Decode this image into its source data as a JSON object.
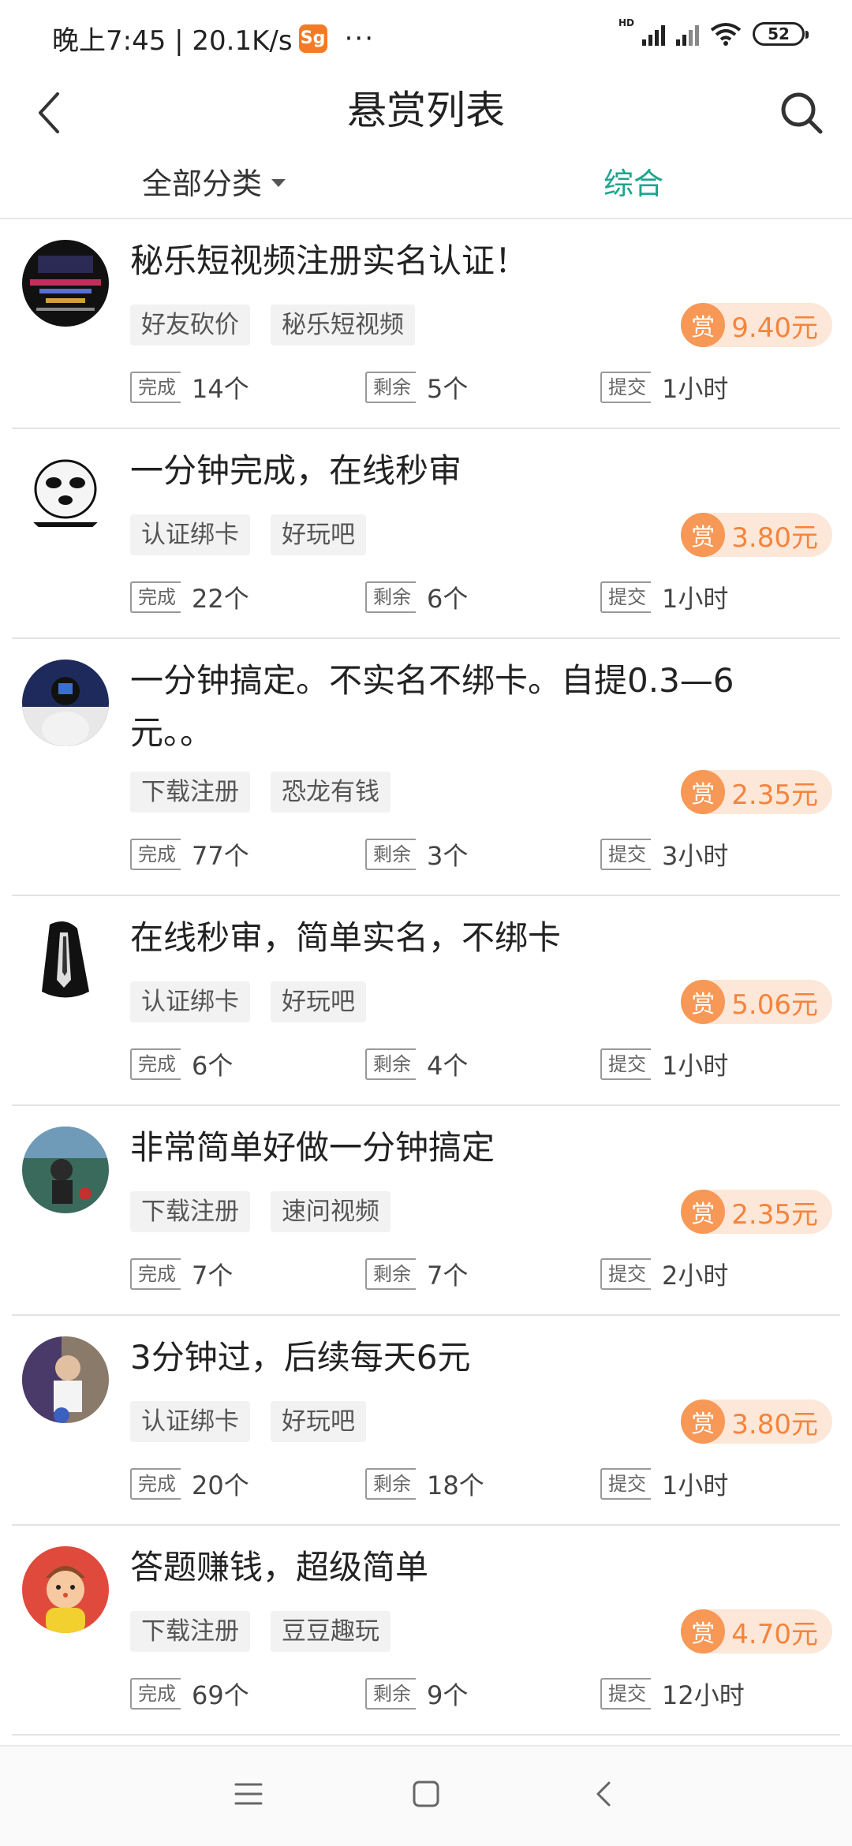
{
  "status_bar": {
    "time_speed": "晚上7:45 | 20.1K/s",
    "app_icon_text": "Sg",
    "more": "···",
    "hd": "HD",
    "battery": "52"
  },
  "header": {
    "title": "悬赏列表",
    "back_icon": "chevron-left-icon",
    "search_icon": "search-icon"
  },
  "filters": {
    "category": "全部分类",
    "sort": "综合"
  },
  "labels": {
    "done": "完成",
    "remain": "剩余",
    "submit": "提交",
    "reward_char": "赏"
  },
  "colors": {
    "accent_green": "#1ca58d",
    "reward_orange": "#f4843c",
    "reward_bg": "#fde7d8"
  },
  "tasks": [
    {
      "title": "秘乐短视频注册实名认证！",
      "tags": [
        "好友砍价",
        "秘乐短视频"
      ],
      "reward": "9.40元",
      "done": "14个",
      "remain": "5个",
      "submit": "1小时"
    },
    {
      "title": "一分钟完成，在线秒审",
      "tags": [
        "认证绑卡",
        "好玩吧"
      ],
      "reward": "3.80元",
      "done": "22个",
      "remain": "6个",
      "submit": "1小时"
    },
    {
      "title": "一分钟搞定。不实名不绑卡。自提0.3—6元。。",
      "tags": [
        "下载注册",
        "恐龙有钱"
      ],
      "reward": "2.35元",
      "done": "77个",
      "remain": "3个",
      "submit": "3小时"
    },
    {
      "title": "在线秒审，简单实名，不绑卡",
      "tags": [
        "认证绑卡",
        "好玩吧"
      ],
      "reward": "5.06元",
      "done": "6个",
      "remain": "4个",
      "submit": "1小时"
    },
    {
      "title": "非常简单好做一分钟搞定",
      "tags": [
        "下载注册",
        "速问视频"
      ],
      "reward": "2.35元",
      "done": "7个",
      "remain": "7个",
      "submit": "2小时"
    },
    {
      "title": "3分钟过，后续每天6元",
      "tags": [
        "认证绑卡",
        "好玩吧"
      ],
      "reward": "3.80元",
      "done": "20个",
      "remain": "18个",
      "submit": "1小时"
    },
    {
      "title": "答题赚钱，超级简单",
      "tags": [
        "下载注册",
        "豆豆趣玩"
      ],
      "reward": "4.70元",
      "done": "69个",
      "remain": "9个",
      "submit": "12小时"
    }
  ],
  "nav": {
    "menu_icon": "menu-icon",
    "home_icon": "home-square-icon",
    "back_icon": "back-triangle-icon"
  }
}
